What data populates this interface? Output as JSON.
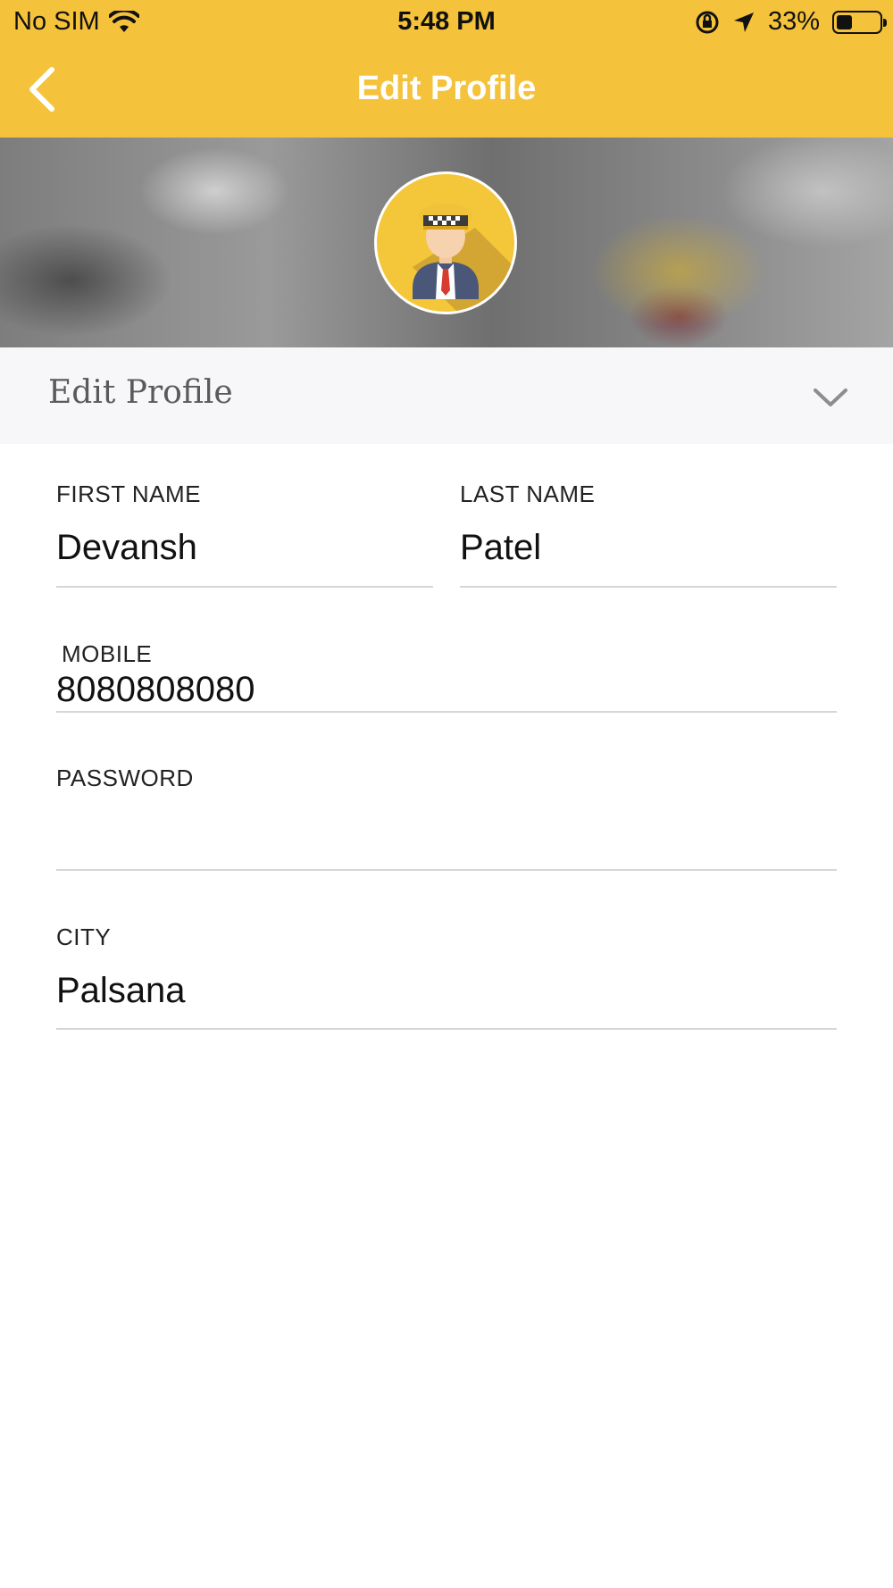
{
  "status_bar": {
    "carrier": "No SIM",
    "time": "5:48 PM",
    "battery": "33%",
    "battery_level": 0.33
  },
  "nav": {
    "title": "Edit Profile"
  },
  "section": {
    "title": "Edit Profile"
  },
  "form": {
    "first_name": {
      "label": "FIRST NAME",
      "value": "Devansh"
    },
    "last_name": {
      "label": "LAST NAME",
      "value": "Patel"
    },
    "mobile": {
      "label": "MOBILE",
      "value": "8080808080"
    },
    "password": {
      "label": "PASSWORD",
      "value": ""
    },
    "city": {
      "label": "CITY",
      "value": "Palsana"
    }
  },
  "colors": {
    "accent": "#f5c33b",
    "section_bg": "#f7f7f9",
    "divider": "#d6d6d6"
  },
  "icons": {
    "back": "chevron-left-icon",
    "expand": "chevron-down-icon",
    "avatar": "taxi-driver-avatar"
  }
}
